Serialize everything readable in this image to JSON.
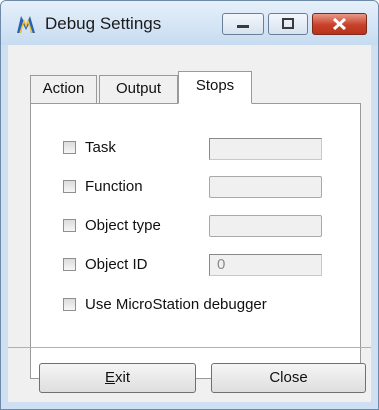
{
  "window": {
    "title": "Debug Settings",
    "icon": "microstation-icon"
  },
  "caption_buttons": {
    "minimize": "minimize-icon",
    "maximize": "maximize-icon",
    "close": "close-icon"
  },
  "tabs": [
    {
      "label": "Action"
    },
    {
      "label": "Output"
    },
    {
      "label": "Stops",
      "active": true
    }
  ],
  "stops": [
    {
      "label": "Task",
      "checked": false,
      "field_value": ""
    },
    {
      "label": "Function",
      "checked": false,
      "field_value": ""
    },
    {
      "label": "Object type",
      "checked": false,
      "field_value": ""
    },
    {
      "label": "Object ID",
      "checked": false,
      "field_value": "0"
    },
    {
      "label": "Use MicroStation debugger",
      "checked": false
    }
  ],
  "buttons": {
    "exit_prefix": "E",
    "exit_rest": "xit",
    "close": "Close"
  },
  "colors": {
    "close_button": "#c7412a",
    "title_gradient": "#c7dcf1"
  }
}
